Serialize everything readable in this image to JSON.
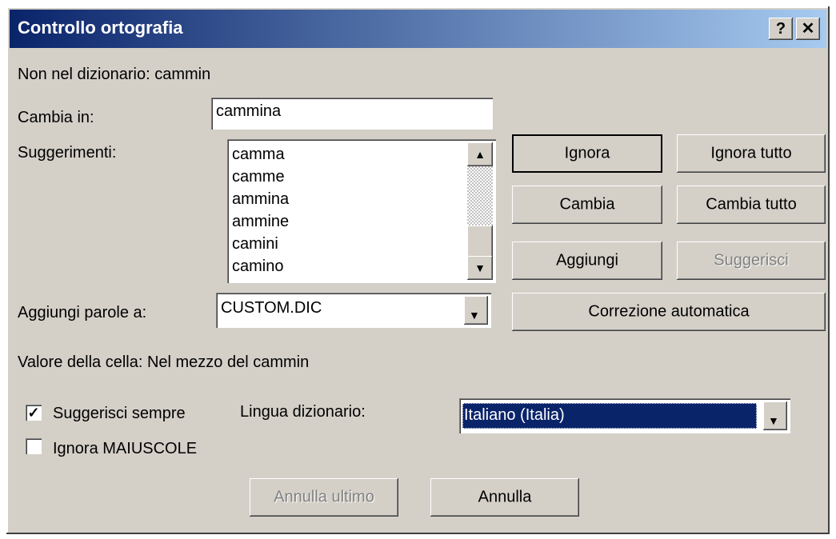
{
  "window": {
    "title": "Controllo ortografia",
    "help_glyph": "?",
    "close_glyph": "✕"
  },
  "not_in_dictionary": "Non nel dizionario: cammin",
  "change_to": {
    "label": "Cambia in:",
    "value": "cammina"
  },
  "suggestions": {
    "label": "Suggerimenti:",
    "items": [
      "camma",
      "camme",
      "ammina",
      "ammine",
      "camini",
      "camino"
    ]
  },
  "add_words_to": {
    "label": "Aggiungi parole a:",
    "value": "CUSTOM.DIC"
  },
  "buttons": {
    "ignore": "Ignora",
    "ignore_all": "Ignora tutto",
    "change": "Cambia",
    "change_all": "Cambia tutto",
    "add": "Aggiungi",
    "suggest": "Suggerisci",
    "autocorrect": "Correzione automatica",
    "undo_last": "Annulla ultimo",
    "cancel": "Annulla"
  },
  "cell_value": "Valore della cella: Nel mezzo del cammin",
  "always_suggest": {
    "label": "Suggerisci sempre",
    "checked": true
  },
  "ignore_uppercase": {
    "label": "Ignora MAIUSCOLE",
    "checked": false
  },
  "dictionary_language": {
    "label": "Lingua dizionario:",
    "value": "Italiano (Italia)"
  },
  "colors": {
    "title_bar_start": "#0a246a",
    "title_bar_end": "#a6caf0",
    "face": "#d4d0c8",
    "selection": "#0a246a"
  }
}
